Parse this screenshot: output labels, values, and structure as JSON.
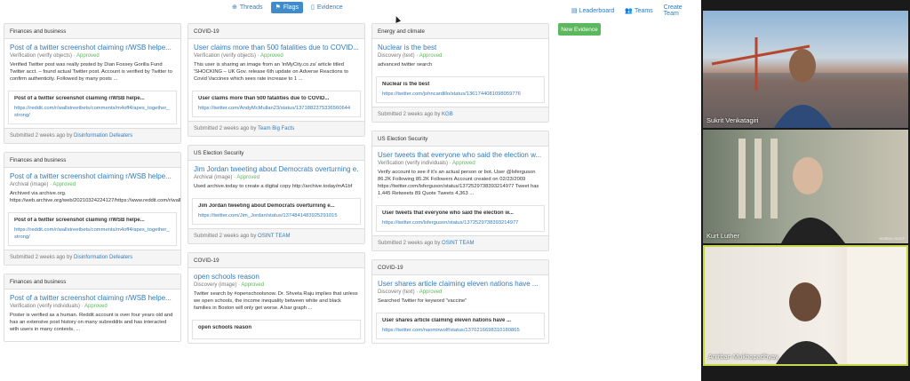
{
  "nav": {
    "tabs": [
      {
        "label": "Threads",
        "icon": "globe-icon"
      },
      {
        "label": "Flags",
        "icon": "flag-icon",
        "active": true
      },
      {
        "label": "Evidence",
        "icon": "document-icon"
      }
    ],
    "right": [
      {
        "label": "Leaderboard",
        "icon": "chart-icon"
      },
      {
        "label": "Teams",
        "icon": "users-icon"
      },
      {
        "label": "Create Team"
      }
    ]
  },
  "new_evidence_label": "New Evidence",
  "columns": [
    [
      {
        "header": "Finances and business",
        "title": "Post of a twitter screenshot claiming r/WSB helpe...",
        "type": "Verification (verify objects)",
        "status": "Approved",
        "desc": "Verified Twitter post was really posted by Dian Fossey Gorilla Fund Twitter acct. – found actual Twitter post. Account is verified by Twitter to confirm authenticity. Followed by many posts ...",
        "inner_title": "Post of a twitter screenshot claiming r/WSB helpe...",
        "inner_link": "https://reddit.com/r/wallstreetbets/comments/m4off4/apes_together_strong/",
        "submitted": "Submitted 2 weeks ago by",
        "team": "Disinformation Defeaters"
      },
      {
        "header": "Finances and business",
        "title": "Post of a twitter screenshot claiming r/WSB helpe...",
        "type": "Archival (image)",
        "status": "Approved",
        "desc": "Archived via archive.org. https://web.archive.org/web/20210324224127/https://www.reddit.com/r/wallstreetbets/comments/m4off4/apes_together_strong/",
        "inner_title": "Post of a twitter screenshot claiming r/WSB helpe...",
        "inner_link": "https://reddit.com/r/wallstreetbets/comments/m4off4/apes_together_strong/",
        "submitted": "Submitted 2 weeks ago by",
        "team": "Disinformation Defeaters"
      },
      {
        "header": "Finances and business",
        "title": "Post of a twitter screenshot claiming r/WSB helpe...",
        "type": "Verification (verify individuals)",
        "status": "Approved",
        "desc": "Poster is verified as a human. Reddit account is over four years old and has an extensive post history on many subreddits and has interacted with users in many contexts, ...",
        "inner_title": "",
        "inner_link": "",
        "submitted": "",
        "team": ""
      }
    ],
    [
      {
        "header": "COVID-19",
        "title": "User claims more than 500 fatalities due to COVID...",
        "type": "Verification (verify objects)",
        "status": "Approved",
        "desc": "This user is sharing an image from an 'inMyCity.co.za' article titled 'SHOCKING – UK Gov. release 6th update on Adverse Reactions to Covid Vaccines which sees rate increase to 1 ...",
        "inner_title": "User claims more than 500 fatalities due to COVID...",
        "inner_link": "https://twitter.com/AndyMcMullan23/status/1371882375336560644",
        "submitted": "Submitted 2 weeks ago by",
        "team": "Team Big Facts"
      },
      {
        "header": "US Election Security",
        "title": "Jim Jordan tweeting about Democrats overturning e...",
        "type": "Archival (image)",
        "status": "Approved",
        "desc": "Used archive.today to create a digital copy http://archive.today/mA1bf",
        "inner_title": "Jim Jordan tweeting about Democrats overturning e...",
        "inner_link": "https://twitter.com/Jim_Jordan/status/1374841483925291015",
        "submitted": "Submitted 2 weeks ago by",
        "team": "OSINT TEAM"
      },
      {
        "header": "COVID-19",
        "title": "open schools reason",
        "type": "Discovery (image)",
        "status": "Approved",
        "desc": "Twitter search by #openschoolsnow. Dr. Shveta Raju implies that unless we open schools, the income inequality between white and black families in Boston will only get worse. A bar graph ...",
        "inner_title": "open schools reason",
        "inner_link": "",
        "submitted": "",
        "team": ""
      }
    ],
    [
      {
        "header": "Energy and climate",
        "title": "Nuclear is the best",
        "type": "Discovery (text)",
        "status": "Approved",
        "desc": "advanced twitter search",
        "inner_title": "Nuclear is the best",
        "inner_link": "https://twitter.com/johncardillo/status/1361744081098059776",
        "submitted": "Submitted 2 weeks ago by",
        "team": "KGB"
      },
      {
        "header": "US Election Security",
        "title": "User tweets that everyone who said the election w...",
        "type": "Verification (verify individuals)",
        "status": "Approved",
        "desc": "Verify account to see if it's an actual person or bot. User @lsferguson 86.2K Following 85.2K Followers Account created on 02/23/2009 https://twitter.com/lsferguson/status/1372529738393214977 Tweet has 1,445 Retweets 89 Quote Tweets 4,363 ...",
        "inner_title": "User tweets that everyone who said the election w...",
        "inner_link": "https://twitter.com/lsferguson/status/1372529738393214977",
        "submitted": "Submitted 2 weeks ago by",
        "team": "OSINT TEAM"
      },
      {
        "header": "COVID-19",
        "title": "User shares article claiming eleven nations have ...",
        "type": "Discovery (text)",
        "status": "Approved",
        "desc": "Searched Twitter for keyword \"vaccine\"",
        "inner_title": "User shares article claiming eleven nations have ...",
        "inner_link": "https://twitter.com/naomirwolf/status/1370216698310180865",
        "submitted": "",
        "team": ""
      }
    ]
  ],
  "participants": [
    {
      "name": "Sukrit Venkatagiri"
    },
    {
      "name": "Kurt Luther"
    },
    {
      "name": "Anirban Mukhopadhyay"
    }
  ],
  "watermark": "NORDIC ROOT"
}
